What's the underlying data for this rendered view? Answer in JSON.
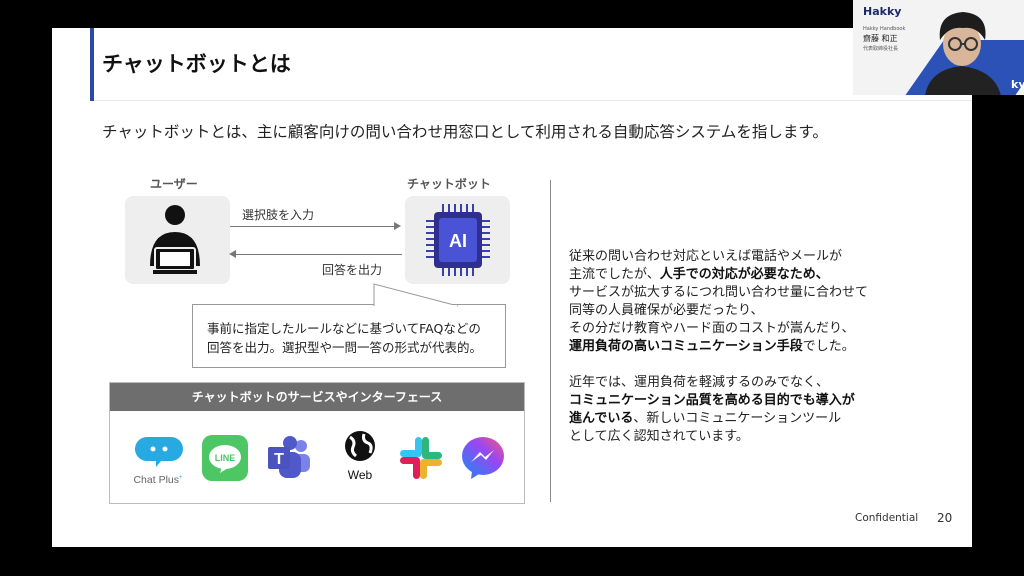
{
  "slide": {
    "title": "チャットボットとは",
    "intro": "チャットボットとは、主に顧客向けの問い合わせ用窓口として利用される自動応答システムを指します。",
    "diagram": {
      "user_label": "ユーザー",
      "bot_label": "チャットボット",
      "bot_chip_text": "AI",
      "arrow_to_bot_label": "選択肢を入力",
      "arrow_to_user_label": "回答を出力",
      "callout_line1": "事前に指定したルールなどに基づいてFAQなどの",
      "callout_line2": "回答を出力。選択型や一問一答の形式が代表的。"
    },
    "services": {
      "header": "チャットボットのサービスやインターフェース",
      "items": [
        {
          "name": "Chat Plus",
          "label": "Chat Plus",
          "label_sup": "+",
          "color": "#29a9e1"
        },
        {
          "name": "LINE",
          "label": "LINE",
          "color": "#4cc764"
        },
        {
          "name": "Microsoft Teams",
          "label": "T",
          "color": "#5059c9"
        },
        {
          "name": "Web",
          "label": "Web",
          "color": "#111111"
        },
        {
          "name": "Slack",
          "label": "",
          "color": "#e01e5a"
        },
        {
          "name": "Messenger",
          "label": "",
          "color": "#7a5cf0"
        }
      ]
    },
    "right_para1": [
      {
        "t": "従来の問い合わせ対応といえば電話やメールが",
        "b": false
      },
      {
        "t": "主流でしたが、",
        "b": false
      },
      {
        "t": "人手での対応が必要なため、",
        "b": true
      },
      {
        "t": "サービスが拡大するにつれ問い合わせ量に合わせて",
        "b": false
      },
      {
        "t": "同等の人員確保が必要だったり、",
        "b": false
      },
      {
        "t": "その分だけ教育やハード面のコストが嵩んだり、",
        "b": false
      },
      {
        "t": "運用負荷の高いコミュニケーション手段",
        "b": true
      },
      {
        "t": "でした。",
        "b": false
      }
    ],
    "right_para2": [
      {
        "t": "近年では、運用負荷を軽減するのみでなく、",
        "b": false
      },
      {
        "t": "コミュニケーション品質を高める目的でも導入が",
        "b": true
      },
      {
        "t": "進んでいる",
        "b": true
      },
      {
        "t": "、新しいコミュニケーションツール",
        "b": false
      },
      {
        "t": "として広く認知されています。",
        "b": false
      }
    ],
    "confidential": "Confidential",
    "page_number": "20"
  },
  "webcam": {
    "brand": "Hakky",
    "subtitle": "Hakky Handbook",
    "person_name": "齋藤 和正",
    "role": "代表取締役社長",
    "tail_text": "ky"
  },
  "colors": {
    "accent": "#2b4aa8",
    "header_gray": "#6e6e6e",
    "bot_chip": "#3a3fb0"
  }
}
